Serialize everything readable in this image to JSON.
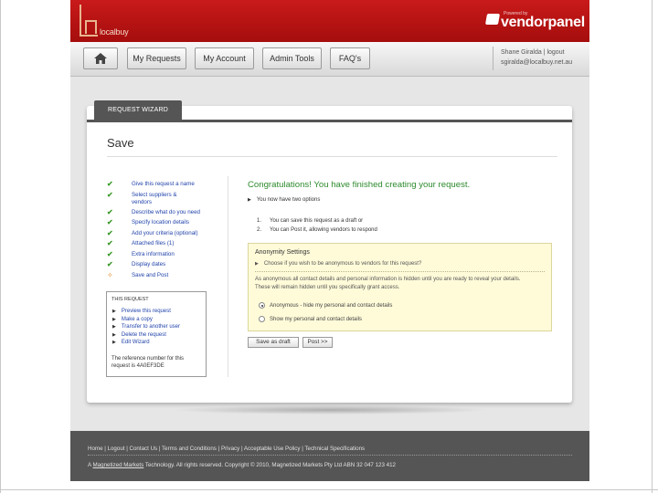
{
  "header": {
    "logo_text": "localbuy",
    "powered_by": "Powered by",
    "brand": "vendorpanel"
  },
  "nav": {
    "home": "home-icon",
    "my_requests": "My Requests",
    "my_account": "My Account",
    "admin_tools": "Admin Tools",
    "faqs": "FAQ's",
    "user_name": "Shane Giralda | logout",
    "user_email": "sgiralda@localbuy.net.au"
  },
  "wizard": {
    "tab_label": "REQUEST WIZARD",
    "title": "Save",
    "steps": [
      {
        "label": "Give this request a name",
        "status": "done"
      },
      {
        "label": "Select suppliers & vendors",
        "status": "done"
      },
      {
        "label": "Describe what do you need",
        "status": "done"
      },
      {
        "label": "Specify location details",
        "status": "done"
      },
      {
        "label": "Add your criteria (optional)",
        "status": "done"
      },
      {
        "label": "Attached files (1)",
        "status": "done"
      },
      {
        "label": "Extra information",
        "status": "done"
      },
      {
        "label": "Display dates",
        "status": "done"
      },
      {
        "label": "Save and Post",
        "status": "current"
      }
    ]
  },
  "request_box": {
    "title": "This Request",
    "actions": [
      "Preview this request",
      "Make a copy",
      "Transfer to another user",
      "Delete the request",
      "Edit Wizard"
    ],
    "reference_text": "The reference number for this request is 4A0EF3DE"
  },
  "main": {
    "congrats": "Congratulations! You have finished creating your request.",
    "options_intro": "You now have two options",
    "options": [
      {
        "num": "1.",
        "text": "You can save this request as a draft or"
      },
      {
        "num": "2.",
        "text": "You can Post it, allowing vendors to respond"
      }
    ]
  },
  "anonymity": {
    "title": "Anonymity Settings",
    "question": "Choose if you wish to be anonymous to vendors for this request?",
    "para1": "As anonymous all contact details and personal information is hidden until you are ready to reveal your details.",
    "para2": "These will remain hidden until you specifically grant access.",
    "options": [
      {
        "label": "Anonymous - hide my personal and contact details",
        "selected": true
      },
      {
        "label": "Show my personal and contact details",
        "selected": false
      }
    ]
  },
  "buttons": {
    "save_draft": "Save as draft",
    "post": "Post >>"
  },
  "footer": {
    "links": "Home | Logout | Contact Us | Terms and Conditions | Privacy | Acceptable Use Policy | Technical Specifications",
    "copyright_prefix": "A",
    "copyright_brand": "Magnetized Markets",
    "copyright_suffix": "Technology. All rights reserved. Copyright © 2010, Magnetized Markets Pty Ltd ABN 32 047 123 412"
  },
  "colors": {
    "header_red": "#b51313",
    "congrats_green": "#2d8a2d",
    "link_blue": "#2244aa",
    "check_green": "#3d9a2d",
    "anon_bg": "#fffbd9",
    "footer_bg": "#555555"
  }
}
